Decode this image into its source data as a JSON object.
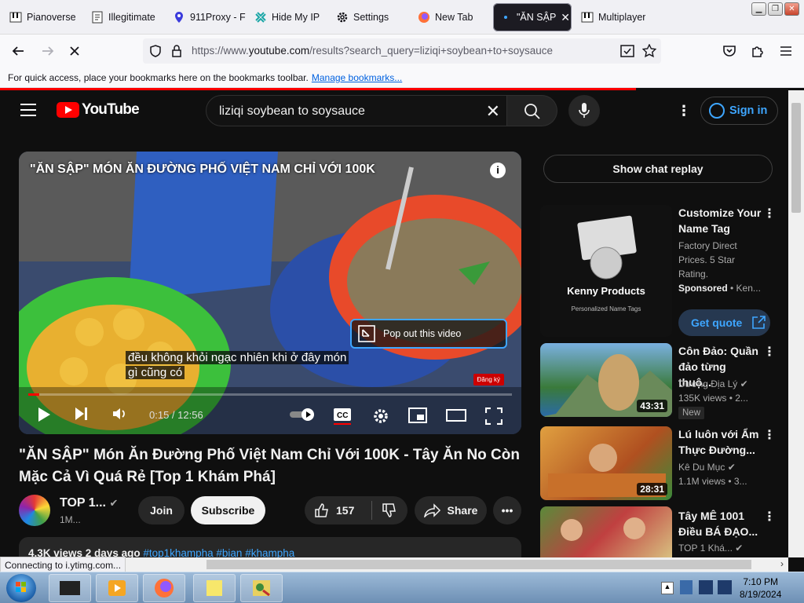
{
  "browser": {
    "tabs": [
      {
        "label": "Pianoverse",
        "icon": "pianoverse-icon"
      },
      {
        "label": "Illegitimate",
        "icon": "page-icon"
      },
      {
        "label": "911Proxy - F",
        "icon": "proxy-icon"
      },
      {
        "label": "Hide My IP",
        "icon": "hidemyip-icon"
      },
      {
        "label": "Settings",
        "icon": "gear-icon"
      },
      {
        "label": "New Tab",
        "icon": "firefox-icon"
      },
      {
        "label": "\"ĂN SẬP",
        "icon": "youtube-icon"
      },
      {
        "label": "Multiplayer",
        "icon": "piano-icon"
      }
    ],
    "url_prefix": "https://www.",
    "url_domain": "youtube.com",
    "url_rest": "/results?search_query=liziqi+soybean+to+soysauce",
    "bookmarks_text": "For quick access, place your bookmarks here on the bookmarks toolbar.",
    "bookmarks_link": "Manage bookmarks...",
    "status_text": "Connecting to i.ytimg.com..."
  },
  "youtube": {
    "logo_text": "YouTube",
    "search_query": "liziqi soybean to soysauce",
    "sign_in": "Sign in"
  },
  "player": {
    "overlay_title": "\"ĂN SẬP\" MÓN ĂN ĐƯỜNG PHỐ VIỆT NAM CHỈ VỚI 100K",
    "popout_label": "Pop out this video",
    "subtitle_line1": "đều không khỏi ngạc nhiên khi ở đây món",
    "subtitle_line2": "gì cũng có",
    "time_current": "0:15",
    "time_total": "12:56",
    "progress_fraction": 0.023,
    "subscribe_mini": "Đăng ký"
  },
  "video": {
    "title": "\"ĂN SẬP\" Món Ăn Đường Phố Việt Nam Chỉ Với 100K - Tây Ăn No Còn Mặc Cả Vì Quá Rẻ [Top 1 Khám Phá]",
    "channel": "TOP 1...",
    "subs": "1M...",
    "join": "Join",
    "subscribe": "Subscribe",
    "likes": "157",
    "share": "Share",
    "views_date": "4.3K views  2 days ago",
    "hashtags": "#top1khampha #bian #khampha"
  },
  "sidebar": {
    "chat_replay": "Show chat replay",
    "ad": {
      "title": "Customize Your Name Tag",
      "desc": "Factory Direct Prices. 5 Star Rating.",
      "sponsored": "Sponsored",
      "advertiser": "Ken...",
      "cta": "Get quote",
      "thumb_title": "Kenny Products",
      "thumb_sub": "Personalized Name Tags"
    },
    "videos": [
      {
        "title": "Côn Đảo: Quần đảo từng thuộ...",
        "channel": "Dương Địa Lý",
        "meta": "135K views • 2...",
        "duration": "43:31",
        "badge": "New"
      },
      {
        "title": "Lú luôn với Ẩm Thực Đường...",
        "channel": "Kê Du Mục",
        "meta": "1.1M views • 3...",
        "duration": "28:31"
      },
      {
        "title": "Tây MÊ 1001 Điều BÁ ĐẠO...",
        "channel": "TOP 1 Khá...",
        "meta": ""
      }
    ]
  },
  "taskbar": {
    "time": "7:10 PM",
    "date": "8/19/2024"
  }
}
